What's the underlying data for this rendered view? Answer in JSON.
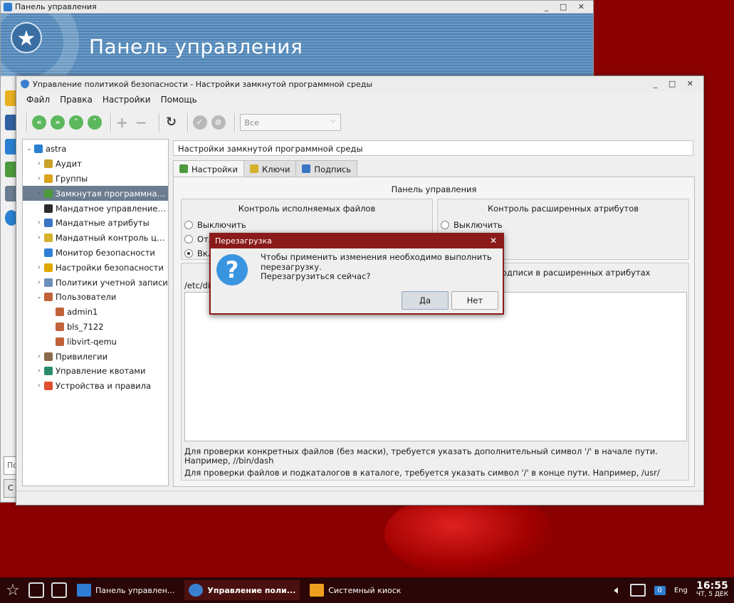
{
  "back_window": {
    "title": "Панель управления",
    "banner_title": "Панель управления",
    "search_placeholder": "По",
    "side_button": "С",
    "controls": "_ □ ✕"
  },
  "main_window": {
    "title": "Управление политикой безопасности - Настройки замкнутой программной среды",
    "controls": "_ □ ✕",
    "menu": [
      "Файл",
      "Правка",
      "Настройки",
      "Помощь"
    ],
    "toolbar": {
      "filter_value": "Все",
      "buttons": [
        "first-icon",
        "last-icon",
        "up-icon",
        "down-icon",
        "add-icon",
        "remove-icon",
        "refresh-icon",
        "apply-icon",
        "cancel-icon"
      ]
    },
    "tree": {
      "root": "astra",
      "items": [
        {
          "label": "Аудит",
          "depth": 1,
          "expand": "›",
          "color": "#c9a227"
        },
        {
          "label": "Группы",
          "depth": 1,
          "expand": "›",
          "color": "#d9a31b"
        },
        {
          "label": "Замкнутая программная ...",
          "depth": 1,
          "expand": "›",
          "color": "#4c9a3c",
          "selected": true
        },
        {
          "label": "Мандатное управление ...",
          "depth": 1,
          "expand": "",
          "color": "#2b2b2b"
        },
        {
          "label": "Мандатные атрибуты",
          "depth": 1,
          "expand": "›",
          "color": "#3a76c4"
        },
        {
          "label": "Мандатный контроль це...",
          "depth": 1,
          "expand": "›",
          "color": "#d4b22a"
        },
        {
          "label": "Монитор безопасности",
          "depth": 1,
          "expand": "",
          "color": "#2f7fd6"
        },
        {
          "label": "Настройки безопасности",
          "depth": 1,
          "expand": "›",
          "color": "#e0a800"
        },
        {
          "label": "Политики учетной записи",
          "depth": 1,
          "expand": "›",
          "color": "#6b8fb8"
        },
        {
          "label": "Пользователи",
          "depth": 1,
          "expand": "⌄",
          "color": "#c0623a"
        },
        {
          "label": "admin1",
          "depth": 2,
          "expand": "",
          "color": "#c0623a"
        },
        {
          "label": "bls_7122",
          "depth": 2,
          "expand": "",
          "color": "#c0623a"
        },
        {
          "label": "libvirt-qemu",
          "depth": 2,
          "expand": "",
          "color": "#c0623a"
        },
        {
          "label": "Привилегии",
          "depth": 1,
          "expand": "›",
          "color": "#8a6a4a"
        },
        {
          "label": "Управление квотами",
          "depth": 1,
          "expand": "›",
          "color": "#2a8a6a"
        },
        {
          "label": "Устройства и правила",
          "depth": 1,
          "expand": "›",
          "color": "#e05030"
        }
      ]
    },
    "content": {
      "section_title": "Настройки замкнутой программной среды",
      "tabs": [
        {
          "label": "Настройки",
          "color": "#4c9a3c",
          "active": true
        },
        {
          "label": "Ключи",
          "color": "#d4b22a"
        },
        {
          "label": "Подпись",
          "color": "#3a76c4"
        }
      ],
      "panel_head": "Панель управления",
      "group_exec": {
        "title": "Контроль исполняемых файлов",
        "options": [
          {
            "label": "Выключить",
            "checked": false
          },
          {
            "label": "Отл",
            "checked": false
          },
          {
            "label": "Вкл",
            "checked": true
          }
        ]
      },
      "group_xattr": {
        "title": "Контроль расширенных атрибутов",
        "options": [
          {
            "label": "Выключить",
            "checked": false
          }
        ]
      },
      "lower_group_title": "одписи в расширенных атрибутах",
      "path_label": "/etc/di",
      "hint1": "Для проверки конкретных файлов (без маски), требуется указать дополнительный символ '/' в начале пути. Например, //bin/dash",
      "hint2": "Для проверки файлов и подкаталогов в каталоге, требуется указать символ '/' в конце пути. Например, /usr/"
    }
  },
  "dialog": {
    "title": "Перезагрузка",
    "message_line1": "Чтобы применить изменения необходимо выполнить перезагрузку.",
    "message_line2": "Перезагрузиться сейчас?",
    "yes": "Да",
    "no": "Нет",
    "close": "✕"
  },
  "taskbar": {
    "tasks": [
      {
        "label": "Панель управлен...",
        "active": false
      },
      {
        "label": "Управление поли...",
        "active": true
      },
      {
        "label": "Системный киоск",
        "active": false
      }
    ],
    "lang": "Eng",
    "badge": "0",
    "time": "16:55",
    "date": "ЧТ, 5 ДЕК"
  }
}
